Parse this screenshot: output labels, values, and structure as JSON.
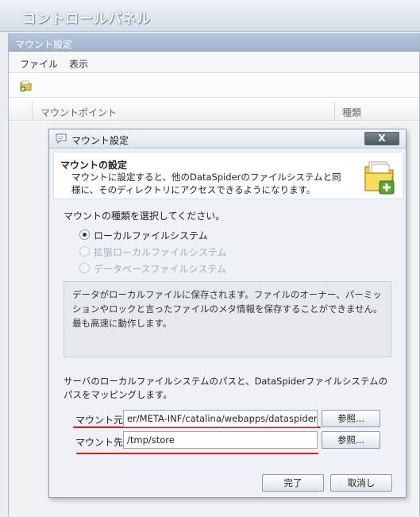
{
  "app": {
    "title": "コントロールパネル"
  },
  "panel": {
    "title": "マウント設定",
    "menu": [
      "ファイル",
      "表示"
    ],
    "columns": [
      "マウントポイント",
      "種類"
    ]
  },
  "dialog": {
    "title": "マウント設定",
    "close_label": "X",
    "header": {
      "title": "マウントの設定",
      "description": "マウントに設定すると、他のDataSpiderのファイルシステムと同様に、そのディレクトリにアクセスできるようになります。"
    },
    "type_prompt": "マウントの種類を選択してください。",
    "types": [
      {
        "label": "ローカルファイルシステム",
        "checked": true,
        "enabled": true
      },
      {
        "label": "拡張ローカルファイルシステム",
        "checked": false,
        "enabled": false
      },
      {
        "label": "データベースファイルシステム",
        "checked": false,
        "enabled": false
      }
    ],
    "type_description": "データがローカルファイルに保存されます。ファイルのオーナー、パーミッションやロックと言ったファイルのメタ情報を保存することができません。最も高速に動作します。",
    "path_description": "サーバのローカルファイルシステムのパスと、DataSpiderファイルシステムのパスをマッピングします。",
    "source": {
      "label": "マウント元",
      "value": "er/META-INF/catalina/webapps/dataspider",
      "browse_label": "参照..."
    },
    "target": {
      "label": "マウント先",
      "value": "/tmp/store",
      "browse_label": "参照..."
    },
    "ok_label": "完了",
    "cancel_label": "取消し"
  },
  "colors": {
    "highlight": "#e1181e"
  }
}
